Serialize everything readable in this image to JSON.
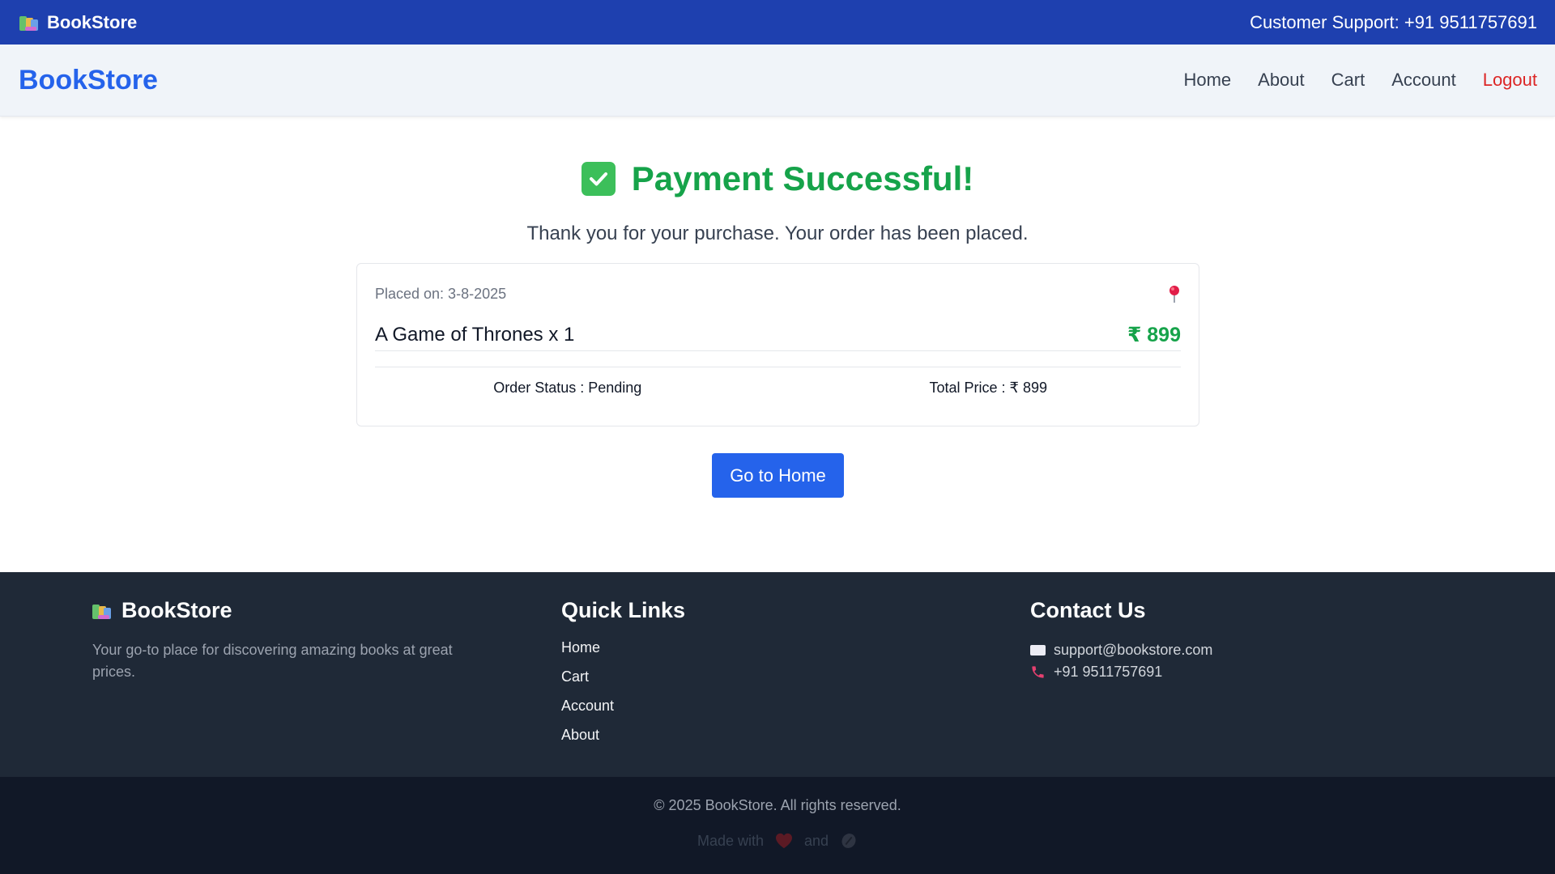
{
  "topbar": {
    "brand": "BookStore",
    "support": "Customer Support: +91 9511757691"
  },
  "navbar": {
    "logo": "BookStore",
    "links": [
      "Home",
      "About",
      "Cart",
      "Account",
      "Logout"
    ]
  },
  "success": {
    "title": "Payment Successful!",
    "message": "Thank you for your purchase. Your order has been placed."
  },
  "order": {
    "placed_on": "Placed on: 3-8-2025",
    "item": "A Game of Thrones x 1",
    "item_price": "₹ 899",
    "status": "Order Status : Pending",
    "total": "Total Price : ₹ 899"
  },
  "actions": {
    "go_home": "Go to Home"
  },
  "footer": {
    "brand": "BookStore",
    "description": "Your go-to place for discovering amazing books at great prices.",
    "quick_links_title": "Quick Links",
    "quick_links": [
      "Home",
      "Cart",
      "Account",
      "About"
    ],
    "contact_title": "Contact Us",
    "email": "support@bookstore.com",
    "phone": "+91 9511757691",
    "copyright": "© 2025 BookStore. All rights reserved.",
    "made_with": "Made with",
    "and": "and"
  },
  "colors": {
    "topbar": "#1e40af",
    "accent": "#2563eb",
    "success": "#16a34a",
    "logout": "#dc2626",
    "footer": "#1f2937",
    "footer_bottom": "#111827"
  },
  "icons": [
    "books-icon",
    "check-icon",
    "pin-icon",
    "mail-icon",
    "phone-icon",
    "heart-icon",
    "coffee-icon"
  ]
}
